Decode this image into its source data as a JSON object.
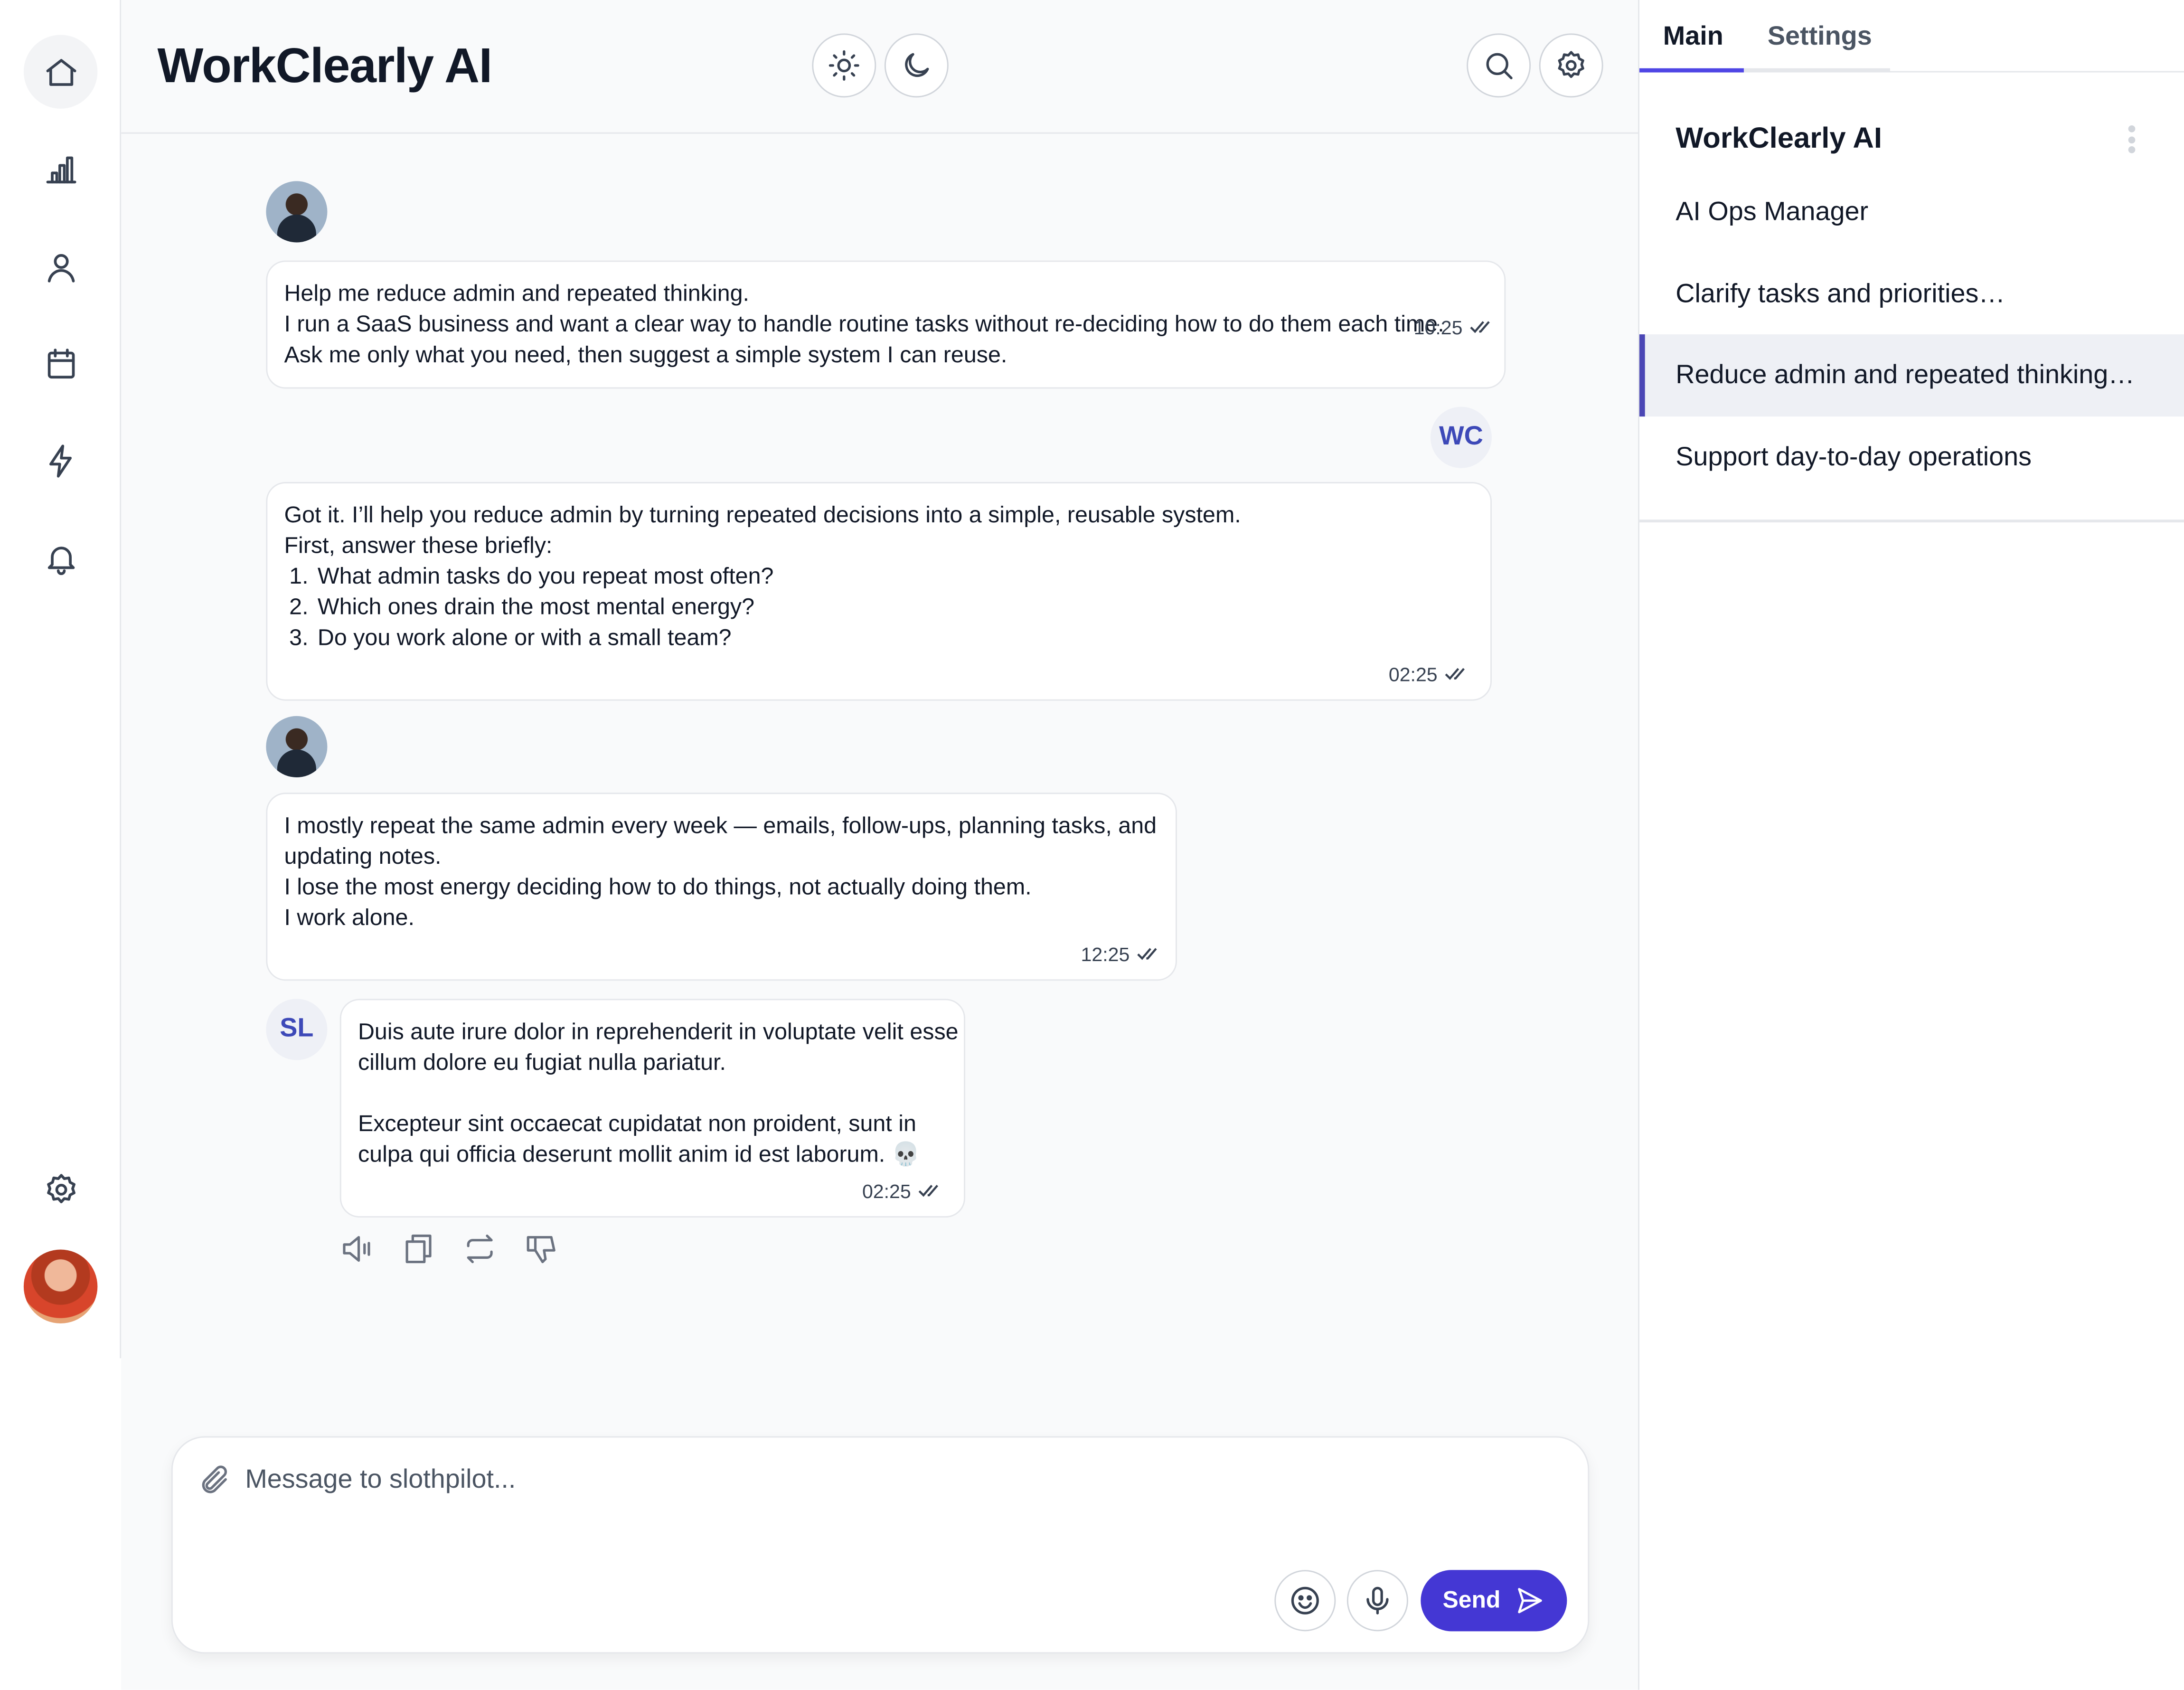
{
  "app": {
    "title": "WorkClearly AI"
  },
  "rail": {
    "items": [
      {
        "icon": "home-icon"
      },
      {
        "icon": "bar-chart-icon"
      },
      {
        "icon": "user-icon"
      },
      {
        "icon": "calendar-icon"
      },
      {
        "icon": "lightning-icon"
      },
      {
        "icon": "bell-icon"
      },
      {
        "icon": "settings-icon"
      }
    ]
  },
  "header": {
    "buttons": [
      "sun-icon",
      "moon-icon",
      "search-icon",
      "gear-icon"
    ]
  },
  "chat": {
    "messages": [
      {
        "sender": "user",
        "lines": [
          "Help me reduce admin and repeated thinking.",
          "I run a SaaS business and want a clear way to handle routine tasks without re-deciding how to do them each time.",
          "Ask me only what you need, then suggest a simple system I can reuse."
        ],
        "time": "10:25"
      },
      {
        "sender": "assistant",
        "initials": "WC",
        "lines": [
          "Got it. I’ll help you reduce admin by turning repeated decisions into a simple, reusable system.",
          "First, answer these briefly:"
        ],
        "list": [
          "What admin tasks do you repeat most often?",
          "Which ones drain the most mental energy?",
          "Do you work alone or with a small team?"
        ],
        "time": "02:25"
      },
      {
        "sender": "user",
        "lines": [
          "I mostly repeat the same admin every week — emails, follow-ups, planning tasks, and",
          "updating notes.",
          "I lose the most energy deciding how to do things, not actually doing them.",
          "I work alone."
        ],
        "time": "12:25"
      },
      {
        "sender": "assistant",
        "initials": "SL",
        "lines": [
          "Duis aute irure dolor in reprehenderit in voluptate velit esse",
          "cillum dolore eu fugiat nulla pariatur.",
          "",
          "Excepteur sint occaecat cupidatat non proident, sunt in",
          "culpa qui officia deserunt mollit anim id est laborum. 💀"
        ],
        "time": "02:25"
      }
    ],
    "message_actions": [
      "speaker-icon",
      "copy-icon",
      "regenerate-icon",
      "thumbs-down-icon"
    ]
  },
  "composer": {
    "placeholder": "Message to slothpilot...",
    "value": "",
    "send_label": "Send"
  },
  "panel": {
    "tabs": [
      "Main",
      "Settings"
    ],
    "active_tab": "Main",
    "title": "WorkClearly AI",
    "items": [
      "AI Ops Manager",
      "Clarify tasks and priorities…",
      "Reduce admin and repeated thinking…",
      "Support day-to-day operations"
    ],
    "active_item": 2
  },
  "colors": {
    "accent": "#4437d4",
    "initials": "#3d49b8"
  }
}
